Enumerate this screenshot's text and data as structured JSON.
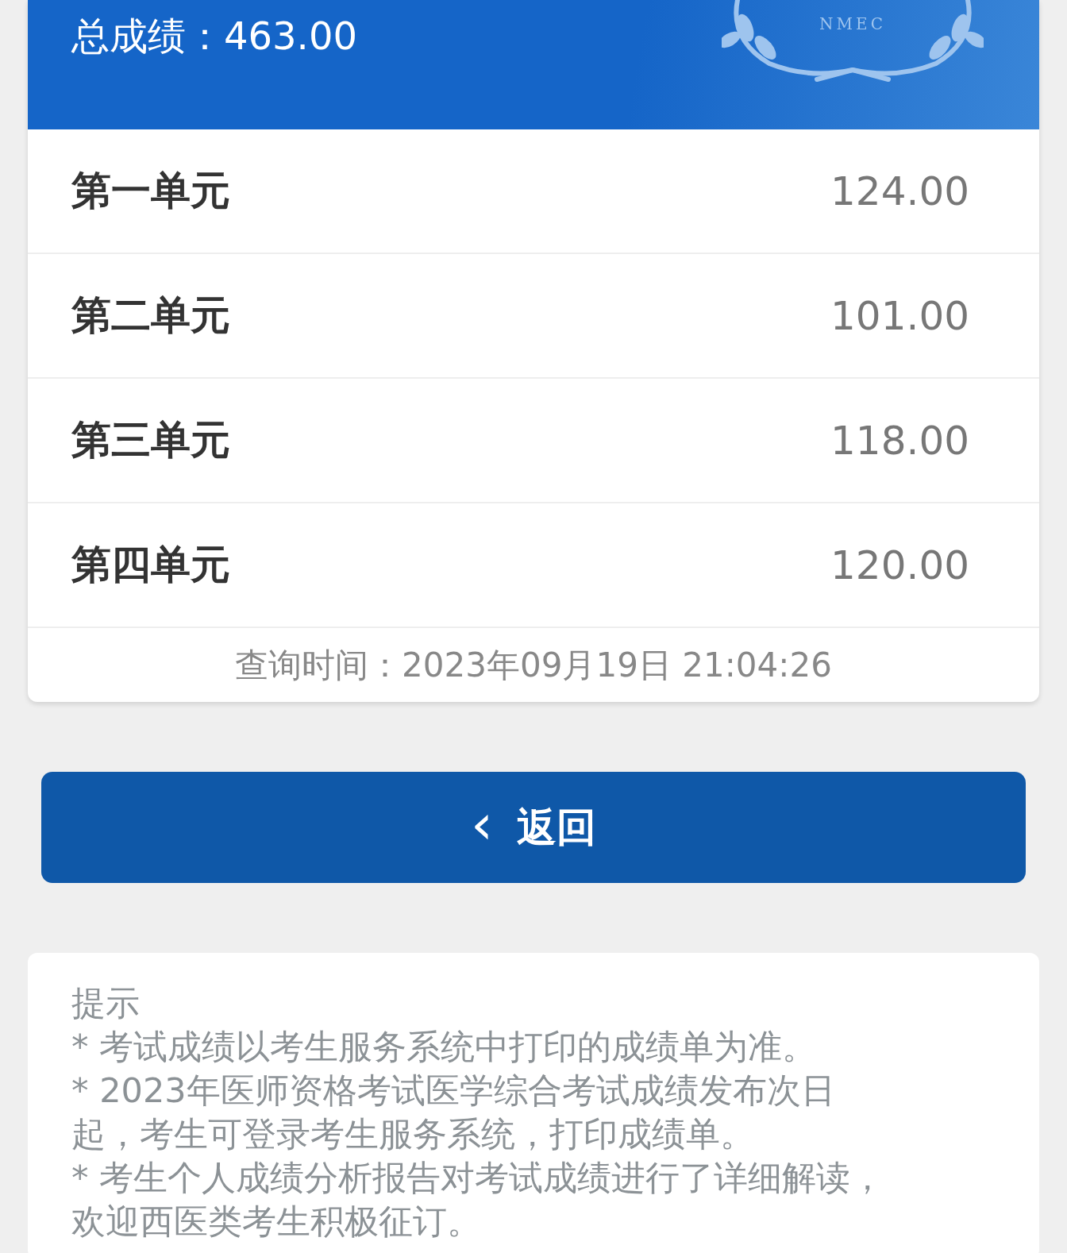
{
  "header": {
    "total_label": "总成绩：",
    "total_value": "463.00",
    "emblem_text": "NMEC"
  },
  "units": [
    {
      "name": "第一单元",
      "score": "124.00"
    },
    {
      "name": "第二单元",
      "score": "101.00"
    },
    {
      "name": "第三单元",
      "score": "118.00"
    },
    {
      "name": "第四单元",
      "score": "120.00"
    }
  ],
  "query_time": "查询时间：2023年09月19日 21:04:26",
  "back_button": {
    "icon": "‹",
    "label": "返回"
  },
  "tips": {
    "title": "提示",
    "items": [
      "* 考试成绩以考生服务系统中打印的成绩单为准。",
      "* 2023年医师资格考试医学综合考试成绩发布次日起，考生可登录考生服务系统，打印成绩单。",
      "* 考生个人成绩分析报告对考试成绩进行了详细解读，欢迎西医类考生积极征订。"
    ]
  }
}
